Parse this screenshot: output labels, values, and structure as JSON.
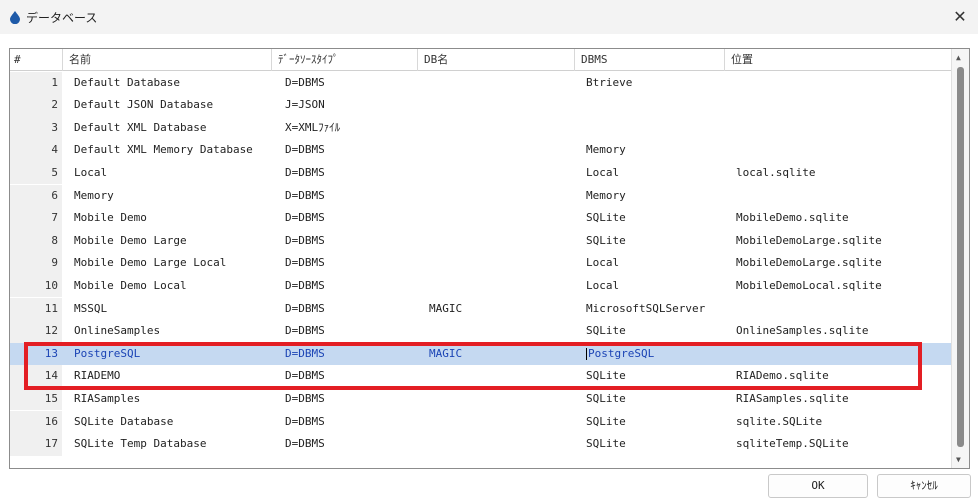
{
  "window": {
    "title": "データベース",
    "close_glyph": "✕"
  },
  "table": {
    "columns": [
      "#",
      "名前",
      "ﾃﾞｰﾀｿｰｽﾀｲﾌﾟ",
      "DB名",
      "DBMS",
      "位置"
    ],
    "rows": [
      {
        "num": "1",
        "name": "Default Database",
        "type": "D=DBMS",
        "db": "",
        "dbms": "Btrieve",
        "loc": ""
      },
      {
        "num": "2",
        "name": "Default JSON Database",
        "type": "J=JSON",
        "db": "",
        "dbms": "",
        "loc": ""
      },
      {
        "num": "3",
        "name": "Default XML Database",
        "type": "X=XMLﾌｧｲﾙ",
        "db": "",
        "dbms": "",
        "loc": ""
      },
      {
        "num": "4",
        "name": "Default XML Memory Database",
        "type": "D=DBMS",
        "db": "",
        "dbms": "Memory",
        "loc": ""
      },
      {
        "num": "5",
        "name": "Local",
        "type": "D=DBMS",
        "db": "",
        "dbms": "Local",
        "loc": "local.sqlite"
      },
      {
        "num": "6",
        "name": "Memory",
        "type": "D=DBMS",
        "db": "",
        "dbms": "Memory",
        "loc": ""
      },
      {
        "num": "7",
        "name": "Mobile Demo",
        "type": "D=DBMS",
        "db": "",
        "dbms": "SQLite",
        "loc": "MobileDemo.sqlite"
      },
      {
        "num": "8",
        "name": "Mobile Demo Large",
        "type": "D=DBMS",
        "db": "",
        "dbms": "SQLite",
        "loc": "MobileDemoLarge.sqlite"
      },
      {
        "num": "9",
        "name": "Mobile Demo Large Local",
        "type": "D=DBMS",
        "db": "",
        "dbms": "Local",
        "loc": "MobileDemoLarge.sqlite"
      },
      {
        "num": "10",
        "name": "Mobile Demo Local",
        "type": "D=DBMS",
        "db": "",
        "dbms": "Local",
        "loc": "MobileDemoLocal.sqlite"
      },
      {
        "num": "11",
        "name": "MSSQL",
        "type": "D=DBMS",
        "db": "MAGIC",
        "dbms": "MicrosoftSQLServer",
        "loc": ""
      },
      {
        "num": "12",
        "name": "OnlineSamples",
        "type": "D=DBMS",
        "db": "",
        "dbms": "SQLite",
        "loc": "OnlineSamples.sqlite"
      },
      {
        "num": "13",
        "name": "PostgreSQL",
        "type": "D=DBMS",
        "db": "MAGIC",
        "dbms": "PostgreSQL",
        "loc": "",
        "selected": true
      },
      {
        "num": "14",
        "name": "RIADEMO",
        "type": "D=DBMS",
        "db": "",
        "dbms": "SQLite",
        "loc": "RIADemo.sqlite"
      },
      {
        "num": "15",
        "name": "RIASamples",
        "type": "D=DBMS",
        "db": "",
        "dbms": "SQLite",
        "loc": "RIASamples.sqlite"
      },
      {
        "num": "16",
        "name": "SQLite Database",
        "type": "D=DBMS",
        "db": "",
        "dbms": "SQLite",
        "loc": "sqlite.SQLite"
      },
      {
        "num": "17",
        "name": "SQLite Temp Database",
        "type": "D=DBMS",
        "db": "",
        "dbms": "SQLite",
        "loc": "sqliteTemp.SQLite"
      }
    ]
  },
  "buttons": {
    "ok": "OK",
    "cancel": "ｷｬﾝｾﾙ"
  },
  "colors": {
    "selection": "#c5d9f1",
    "selected_text": "#1b44b5",
    "highlight_box": "#e31e24",
    "app_icon": "#1e5aa8"
  },
  "icons": {
    "app": "database-drop-icon",
    "close": "close-icon"
  }
}
